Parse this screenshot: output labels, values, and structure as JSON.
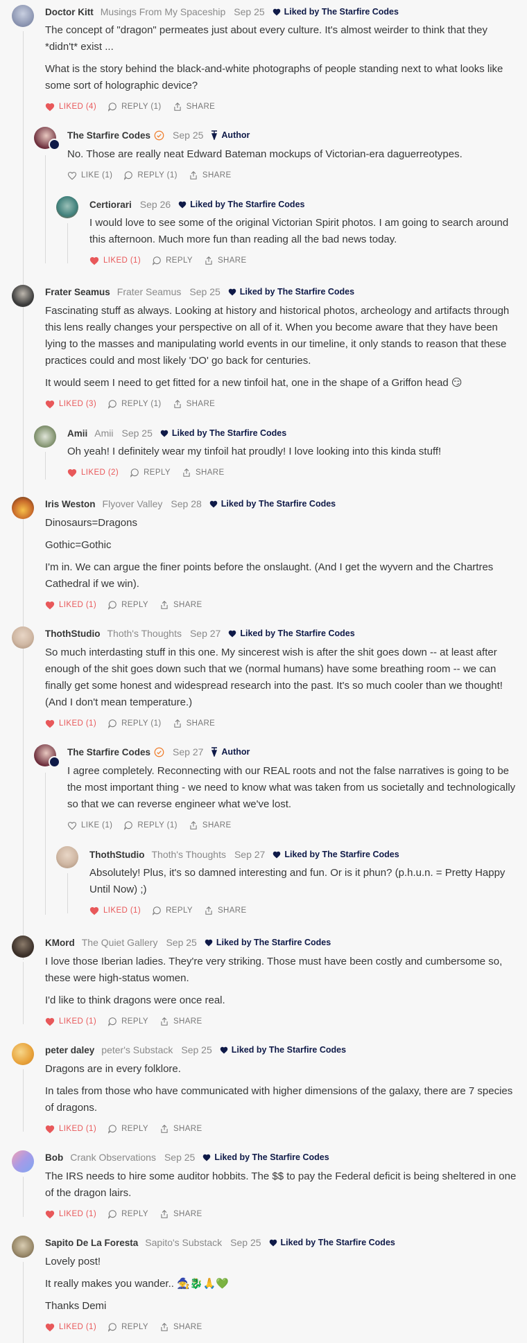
{
  "comments": [
    {
      "author": "Doctor Kitt",
      "pub": "Musings From My Spaceship",
      "date": "Sep 25",
      "badge": "Liked by The Starfire Codes",
      "badge_type": "liked",
      "paragraphs": [
        "The concept of \"dragon\" permeates just about every culture. It's almost weirder to think that they *didn't* exist ...",
        "What is the story behind the black-and-white photographs of people standing next to what looks like some sort of holographic device?"
      ],
      "like_label": "LIKED (4)",
      "liked": true,
      "reply_label": "REPLY (1)",
      "share_label": "SHARE",
      "avatar_color": "#7a86a8"
    },
    {
      "author": "The Starfire Codes",
      "pub": "",
      "date": "Sep 25",
      "badge": "Author",
      "badge_type": "author",
      "paragraphs": [
        "No. Those are really neat Edward Bateman mockups of Victorian-era daguerreotypes."
      ],
      "like_label": "LIKE (1)",
      "liked": false,
      "reply_label": "REPLY (1)",
      "share_label": "SHARE",
      "avatar_color": "#6b2c3a"
    },
    {
      "author": "Certiorari",
      "pub": "",
      "date": "Sep 26",
      "badge": "Liked by The Starfire Codes",
      "badge_type": "liked",
      "paragraphs": [
        "I would love to see some of the original Victorian Spirit photos. I am going to search around this afternoon. Much more fun than reading all the bad news today."
      ],
      "like_label": "LIKED (1)",
      "liked": true,
      "reply_label": "REPLY",
      "share_label": "SHARE",
      "avatar_color": "#3f7f7a"
    },
    {
      "author": "Frater Seamus",
      "pub": "Frater Seamus",
      "date": "Sep 25",
      "badge": "Liked by The Starfire Codes",
      "badge_type": "liked",
      "paragraphs": [
        "Fascinating stuff as always. Looking at history and historical photos, archeology and artifacts through this lens really changes your perspective on all of it. When you become aware that they have been lying to the masses and manipulating world events in our timeline, it only stands to reason that these practices could and most likely 'DO' go back for centuries.",
        "It would seem I need to get fitted for a new tinfoil hat, one in the shape of a Griffon head 😏"
      ],
      "like_label": "LIKED (3)",
      "liked": true,
      "reply_label": "REPLY (1)",
      "share_label": "SHARE",
      "avatar_color": "#4a4a4a"
    },
    {
      "author": "Amii",
      "pub": "Amii",
      "date": "Sep 25",
      "badge": "Liked by The Starfire Codes",
      "badge_type": "liked",
      "paragraphs": [
        "Oh yeah! I definitely wear my tinfoil hat proudly! I love looking into this kinda stuff!"
      ],
      "like_label": "LIKED (2)",
      "liked": true,
      "reply_label": "REPLY",
      "share_label": "SHARE",
      "avatar_color": "#8a9a78"
    },
    {
      "author": "Iris Weston",
      "pub": "Flyover Valley",
      "date": "Sep 28",
      "badge": "Liked by The Starfire Codes",
      "badge_type": "liked",
      "paragraphs": [
        "Dinosaurs=Dragons",
        "Gothic=Gothic",
        "I'm in. We can argue the finer points before the onslaught. (And I get the wyvern and the Chartres Cathedral if we win)."
      ],
      "like_label": "LIKED (1)",
      "liked": true,
      "reply_label": "REPLY",
      "share_label": "SHARE",
      "avatar_color": "#c86a2a"
    },
    {
      "author": "ThothStudio",
      "pub": "Thoth's Thoughts",
      "date": "Sep 27",
      "badge": "Liked by The Starfire Codes",
      "badge_type": "liked",
      "paragraphs": [
        "So much interdasting stuff in this one. My sincerest wish is after the shit goes down -- at least after enough of the shit goes down such that we (normal humans) have some breathing room -- we can finally get some honest and widespread research into the past. It's so much cooler than we thought! (And I don't mean temperature.)"
      ],
      "like_label": "LIKED (1)",
      "liked": true,
      "reply_label": "REPLY (1)",
      "share_label": "SHARE",
      "avatar_color": "#cfb7a3"
    },
    {
      "author": "The Starfire Codes",
      "pub": "",
      "date": "Sep 27",
      "badge": "Author",
      "badge_type": "author",
      "paragraphs": [
        "I agree completely. Reconnecting with our REAL roots and not the false narratives is going to be the most important thing - we need to know what was taken from us societally and technologically so that we can reverse engineer what we've lost."
      ],
      "like_label": "LIKE (1)",
      "liked": false,
      "reply_label": "REPLY (1)",
      "share_label": "SHARE",
      "avatar_color": "#6b2c3a"
    },
    {
      "author": "ThothStudio",
      "pub": "Thoth's Thoughts",
      "date": "Sep 27",
      "badge": "Liked by The Starfire Codes",
      "badge_type": "liked",
      "paragraphs": [
        "Absolutely! Plus, it's so damned interesting and fun. Or is it phun? (p.h.u.n. = Pretty Happy Until Now) ;)"
      ],
      "like_label": "LIKED (1)",
      "liked": true,
      "reply_label": "REPLY",
      "share_label": "SHARE",
      "avatar_color": "#cfb7a3"
    },
    {
      "author": "KMord",
      "pub": "The Quiet Gallery",
      "date": "Sep 25",
      "badge": "Liked by The Starfire Codes",
      "badge_type": "liked",
      "paragraphs": [
        "I love those Iberian ladies. They're very striking. Those must have been costly and cumbersome so, these were high-status women.",
        "I'd like to think dragons were once real."
      ],
      "like_label": "LIKED (1)",
      "liked": true,
      "reply_label": "REPLY",
      "share_label": "SHARE",
      "avatar_color": "#3a2f28"
    },
    {
      "author": "peter daley",
      "pub": "peter's Substack",
      "date": "Sep 25",
      "badge": "Liked by The Starfire Codes",
      "badge_type": "liked",
      "paragraphs": [
        "Dragons are in every folklore.",
        "In tales from those who have communicated with higher dimensions of the galaxy, there are 7 species of dragons."
      ],
      "like_label": "LIKED (1)",
      "liked": true,
      "reply_label": "REPLY",
      "share_label": "SHARE",
      "avatar_color": "#e8a23a"
    },
    {
      "author": "Bob",
      "pub": "Crank Observations",
      "date": "Sep 25",
      "badge": "Liked by The Starfire Codes",
      "badge_type": "liked",
      "paragraphs": [
        "The IRS needs to hire some auditor hobbits. The $$ to pay the Federal deficit is being sheltered in one of the dragon lairs."
      ],
      "like_label": "LIKED (1)",
      "liked": true,
      "reply_label": "REPLY",
      "share_label": "SHARE",
      "avatar_color": "#8f88d6"
    },
    {
      "author": "Sapito De La Foresta",
      "pub": "Sapito's Substack",
      "date": "Sep 25",
      "badge": "Liked by The Starfire Codes",
      "badge_type": "liked",
      "paragraphs": [
        "Lovely post!",
        "It really makes you wander.. 🧙🐉🙏💚",
        "Thanks Demi"
      ],
      "like_label": "LIKED (1)",
      "liked": true,
      "reply_label": "REPLY",
      "share_label": "SHARE",
      "avatar_color": "#9a8a6a"
    }
  ],
  "ui": {
    "more_label": "···"
  }
}
